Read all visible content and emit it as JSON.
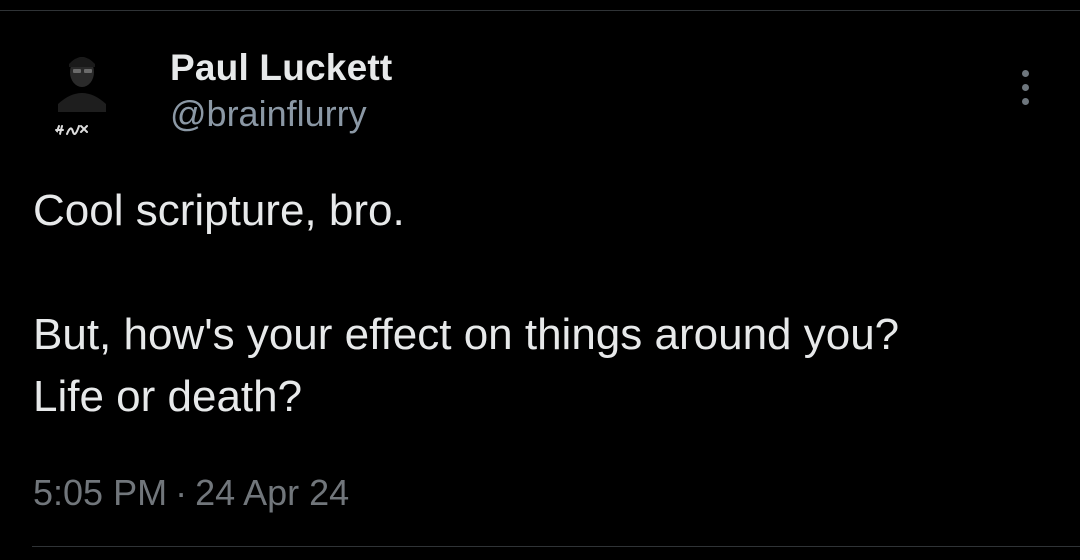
{
  "tweet": {
    "author": {
      "display_name": "Paul Luckett",
      "handle": "@brainflurry",
      "avatar_icon": "user-avatar-photo",
      "avatar_tag": "H-Six"
    },
    "more_icon": "more-vertical-icon",
    "body": {
      "line1": "Cool scripture, bro.",
      "line2": "But, how's your effect on things around you?",
      "line3": "Life or death?"
    },
    "timestamp": {
      "time": "5:05 PM",
      "separator": "·",
      "date": "24 Apr 24"
    }
  },
  "colors": {
    "background": "#000000",
    "primary_text": "#e7e9ea",
    "secondary_text": "#71767b",
    "divider": "#2f3336"
  }
}
